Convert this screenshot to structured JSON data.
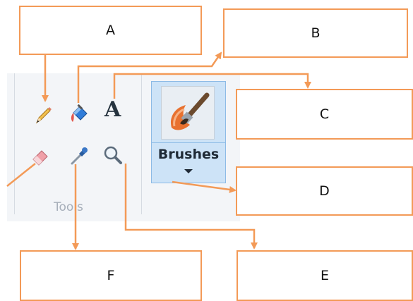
{
  "ribbon": {
    "group_caption": "Tools",
    "brushes_label": "Brushes"
  },
  "tools": {
    "pencil_icon": "pencil-icon",
    "fill_icon": "fill-with-color-icon",
    "text_tool_glyph": "A",
    "eraser_icon": "eraser-icon",
    "color_picker_icon": "color-picker-icon",
    "magnifier_icon": "magnifier-icon",
    "brushes_icon": "brushes-icon"
  },
  "labels": {
    "a": "A",
    "b": "B",
    "c": "C",
    "d": "D",
    "e": "E",
    "f": "F"
  },
  "colors": {
    "connector": "#f39a57",
    "brushes_highlight": "#cde3f7",
    "ribbon_background": "#f3f5f8"
  }
}
